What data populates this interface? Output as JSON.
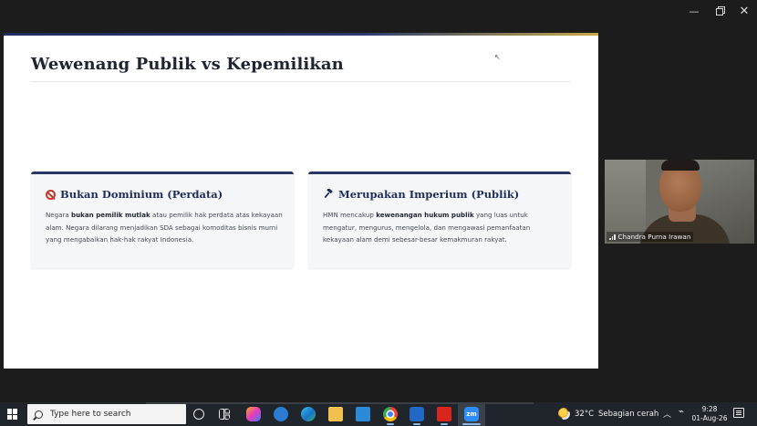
{
  "window": {
    "minimize_glyph": "—",
    "close_glyph": "✕"
  },
  "slide": {
    "title": "Wewenang Publik vs Kepemilikan",
    "cards": [
      {
        "icon": "ban-icon",
        "title": "Bukan Dominium (Perdata)",
        "body_pre": "Negara ",
        "body_bold": "bukan pemilik mutlak",
        "body_post": " atau pemilik hak perdata atas kekayaan alam. Negara dilarang menjadikan SDA sebagai komoditas bisnis murni yang mengabaikan hak-hak rakyat Indonesia."
      },
      {
        "icon": "gavel-icon",
        "title": "Merupakan Imperium (Publik)",
        "body_pre": "HMN mencakup ",
        "body_bold": "kewenangan hukum publik",
        "body_post": " yang luas untuk mengatur, mengurus, mengelola, dan mengawasi pemanfaatan kekayaan alam demi sebesar-besar kemakmuran rakyat."
      }
    ]
  },
  "video": {
    "participant_name": "Chandra Purna Irawan"
  },
  "taskbar": {
    "search_placeholder": "Type here to search",
    "zoom_label": "zm",
    "weather_temp": "32°C",
    "weather_text": "Sebagian cerah",
    "time": "9:28",
    "date": "01-Aug-26"
  },
  "colors": {
    "accent_navy": "#2a3566",
    "ban_red": "#c0392b",
    "taskbar": "#20252b"
  }
}
